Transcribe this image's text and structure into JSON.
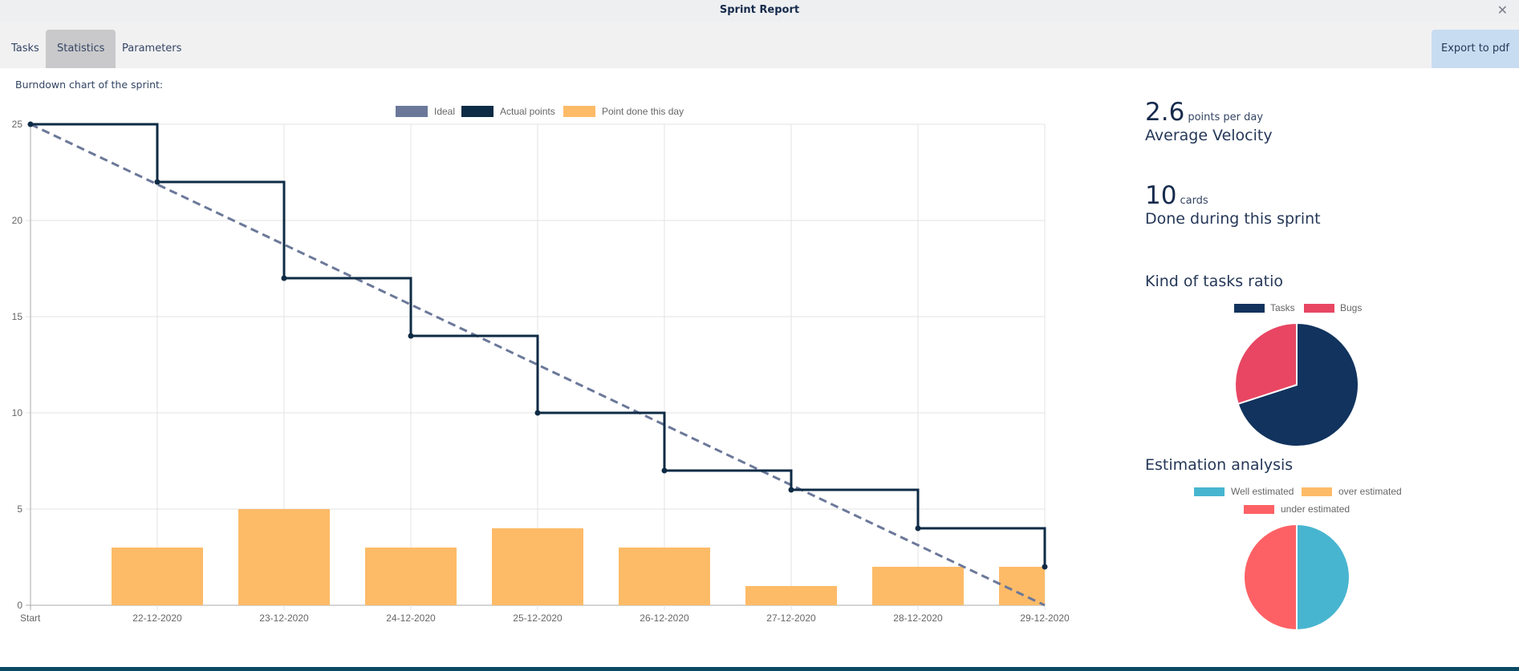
{
  "window": {
    "title": "Sprint Report",
    "close_icon": "close-icon"
  },
  "tabs": [
    {
      "label": "Tasks",
      "active": false
    },
    {
      "label": "Statistics",
      "active": true
    },
    {
      "label": "Parameters",
      "active": false
    }
  ],
  "toolbar": {
    "export_label": "Export to pdf"
  },
  "burndown": {
    "caption": "Burndown chart of the sprint:"
  },
  "stats": {
    "velocity": {
      "value": "2.6",
      "unit": "points per day",
      "label": "Average Velocity"
    },
    "cards": {
      "value": "10",
      "unit": "cards",
      "label": "Done during this sprint"
    }
  },
  "sections": {
    "tasks_ratio": "Kind of tasks ratio",
    "estimation": "Estimation analysis"
  },
  "colors": {
    "ideal": "#6b7899",
    "actual": "#0e2b45",
    "bars": "#fdbb68",
    "tasks": "#11335e",
    "bugs": "#e84663",
    "well": "#48b5d0",
    "over": "#fdbb68",
    "under": "#fd6165"
  },
  "chart_data": [
    {
      "type": "line",
      "title": "Burndown chart of the sprint",
      "categories": [
        "Start",
        "22-12-2020",
        "23-12-2020",
        "24-12-2020",
        "25-12-2020",
        "26-12-2020",
        "27-12-2020",
        "28-12-2020",
        "29-12-2020"
      ],
      "ylim": [
        0,
        25
      ],
      "yticks": [
        0,
        5,
        10,
        15,
        20,
        25
      ],
      "grid": true,
      "legend": "top-center",
      "series": [
        {
          "name": "Ideal",
          "type": "line",
          "style": "dashed",
          "values": [
            25,
            21.875,
            18.75,
            15.625,
            12.5,
            9.375,
            6.25,
            3.125,
            0
          ]
        },
        {
          "name": "Actual points",
          "type": "stepped-line",
          "values": [
            25,
            22,
            17,
            14,
            10,
            7,
            6,
            4,
            2
          ]
        },
        {
          "name": "Point done this day",
          "type": "bar",
          "values": [
            0,
            3,
            5,
            3,
            4,
            3,
            1,
            2,
            2
          ]
        }
      ]
    },
    {
      "type": "pie",
      "title": "Kind of tasks ratio",
      "legend": "top",
      "labels": [
        "Tasks",
        "Bugs"
      ],
      "values": [
        7,
        3
      ]
    },
    {
      "type": "pie",
      "title": "Estimation analysis",
      "legend": "top",
      "labels": [
        "Well estimated",
        "over estimated",
        "under estimated"
      ],
      "values": [
        1,
        0,
        1
      ]
    }
  ]
}
